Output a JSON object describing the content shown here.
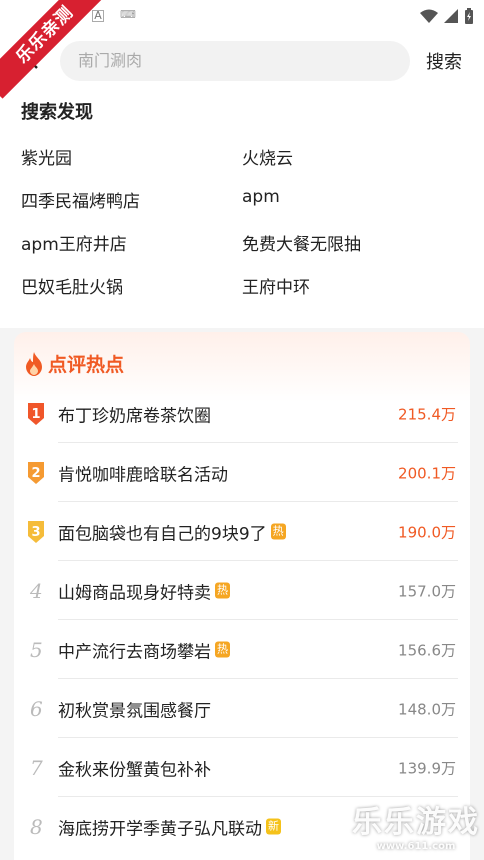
{
  "status_bar": {
    "icons": [
      "wifi-icon",
      "signal-icon",
      "battery-icon"
    ]
  },
  "corner_banner": "乐乐亲测",
  "search": {
    "placeholder": "南门涮肉",
    "button_label": "搜索"
  },
  "discover": {
    "title": "搜索发现",
    "items": [
      "紫光园",
      "火烧云",
      "四季民福烤鸭店",
      "apm",
      "apm王府井店",
      "免费大餐无限抽",
      "巴奴毛肚火锅",
      "王府中环"
    ]
  },
  "hot": {
    "title": "点评热点",
    "items": [
      {
        "rank": "1",
        "label": "布丁珍奶席卷茶饮圈",
        "tag": "",
        "count": "215.4万"
      },
      {
        "rank": "2",
        "label": "肯悦咖啡鹿晗联名活动",
        "tag": "",
        "count": "200.1万"
      },
      {
        "rank": "3",
        "label": "面包脑袋也有自己的9块9了",
        "tag": "热",
        "count": "190.0万"
      },
      {
        "rank": "4",
        "label": "山姆商品现身好特卖",
        "tag": "热",
        "count": "157.0万"
      },
      {
        "rank": "5",
        "label": "中产流行去商场攀岩",
        "tag": "热",
        "count": "156.6万"
      },
      {
        "rank": "6",
        "label": "初秋赏景氛围感餐厅",
        "tag": "",
        "count": "148.0万"
      },
      {
        "rank": "7",
        "label": "金秋来份蟹黄包补补",
        "tag": "",
        "count": "139.9万"
      },
      {
        "rank": "8",
        "label": "海底捞开学季黄子弘凡联动",
        "tag": "新",
        "count": ""
      }
    ]
  },
  "watermark": {
    "big": "乐乐游戏",
    "url": "www.611.com"
  },
  "colors": {
    "accent": "#f05a24",
    "rank1": "#f0562a",
    "rank2": "#f59a32",
    "rank3": "#f5bc3a"
  }
}
